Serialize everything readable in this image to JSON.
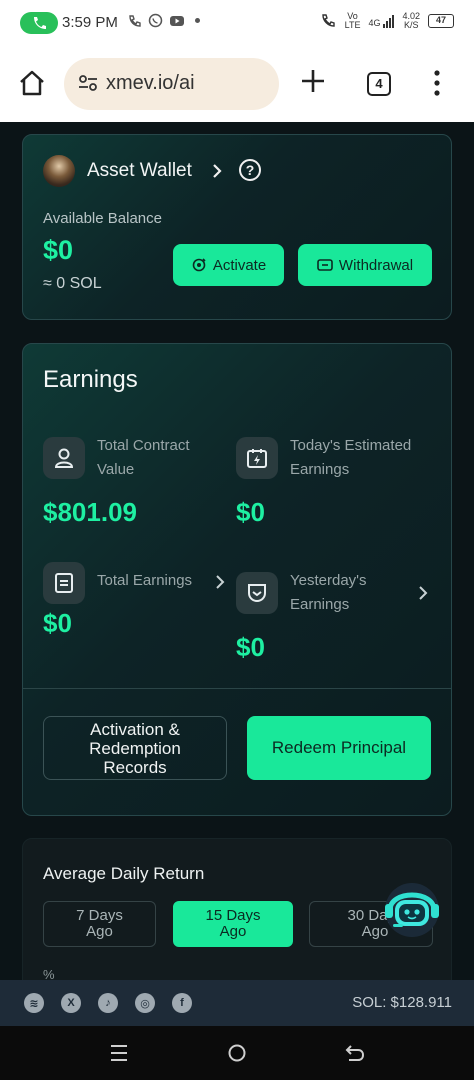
{
  "status_bar": {
    "time": "3:59 PM",
    "network_top": "Vo",
    "network_bottom": "LTE",
    "signal": "4G",
    "speed_value": "4.02",
    "speed_unit": "K/S",
    "battery": "47"
  },
  "browser": {
    "url": "xmev.io/ai",
    "tab_count": "4"
  },
  "wallet": {
    "title": "Asset Wallet",
    "help": "?",
    "available_label": "Available Balance",
    "balance": "$0",
    "balance_sol": "≈ 0 SOL",
    "activate_label": "Activate",
    "withdraw_label": "Withdrawal"
  },
  "earnings": {
    "title": "Earnings",
    "total_contract_label": "Total Contract Value",
    "total_contract_value": "$801.09",
    "todays_estimated_label": "Today's Estimated Earnings",
    "todays_estimated_value": "$0",
    "total_earnings_label": "Total Earnings",
    "total_earnings_value": "$0",
    "yesterdays_label": "Yesterday's Earnings",
    "yesterdays_value": "$0",
    "records_button": "Activation & Redemption Records",
    "redeem_button": "Redeem Principal"
  },
  "average": {
    "title": "Average Daily Return",
    "tabs": [
      "7 Days Ago",
      "15 Days Ago",
      "30 Days Ago"
    ],
    "active_tab": 1,
    "unit": "%"
  },
  "footer": {
    "sol_price": "SOL: $128.911"
  },
  "colors": {
    "accent": "#19e89a",
    "value_green": "#1ef0a2",
    "card_border": "#27474a"
  }
}
